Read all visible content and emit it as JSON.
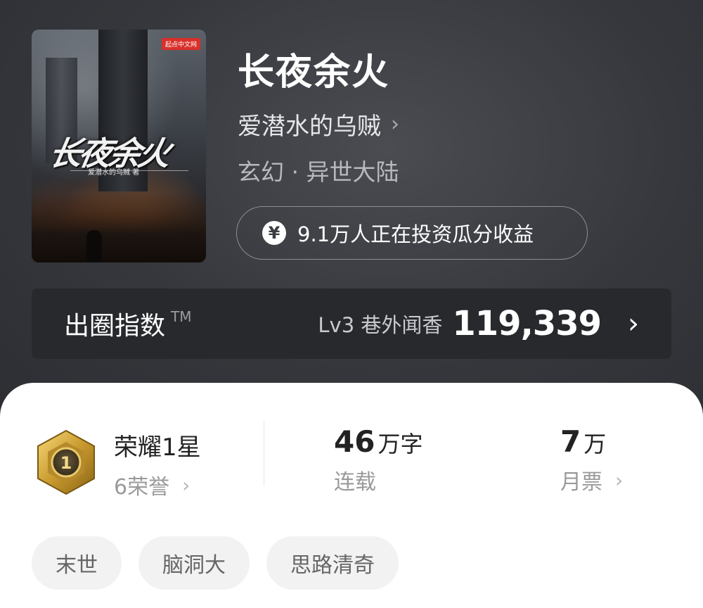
{
  "book": {
    "cover_title": "长夜余火",
    "cover_author": "爱潜水的乌贼 著",
    "cover_publisher": "起点中文网",
    "title": "长夜余火",
    "author": "爱潜水的乌贼",
    "genre": "玄幻 · 异世大陆",
    "invest_text": "9.1万人正在投资瓜分收益"
  },
  "index": {
    "label": "出圈指数",
    "tm": "TM",
    "level": "Lv3 巷外闻香",
    "score": "119,339"
  },
  "stats": {
    "honor_title": "荣耀1星",
    "honor_count": "6荣誉",
    "words_num": "46",
    "words_unit": "万字",
    "status": "连载",
    "tickets_num": "7",
    "tickets_unit": "万",
    "tickets_label": "月票"
  },
  "tags": [
    "末世",
    "脑洞大",
    "思路清奇"
  ]
}
